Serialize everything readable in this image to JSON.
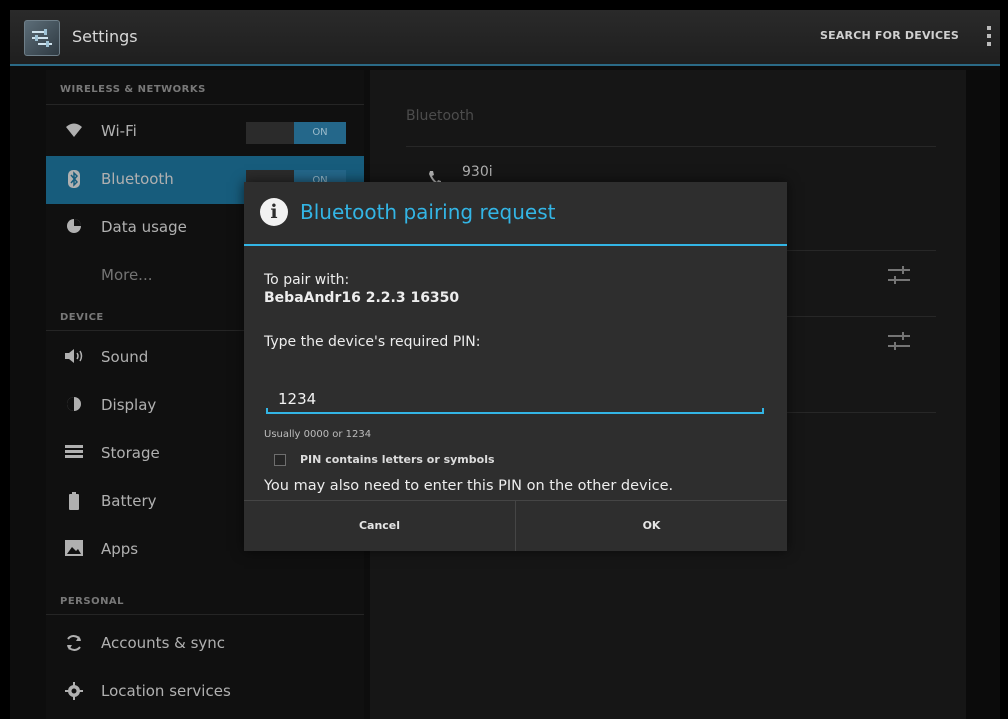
{
  "actionbar": {
    "title": "Settings",
    "search_label": "SEARCH FOR DEVICES"
  },
  "sidebar": {
    "sections": {
      "wireless": "WIRELESS & NETWORKS",
      "device": "DEVICE",
      "personal": "PERSONAL"
    },
    "items": [
      {
        "label": "Wi-Fi",
        "icon": "wifi-icon",
        "toggle": "ON"
      },
      {
        "label": "Bluetooth",
        "icon": "bluetooth-icon",
        "toggle": "ON",
        "active": true
      },
      {
        "label": "Data usage",
        "icon": "data-usage-icon"
      },
      {
        "label": "More..."
      },
      {
        "label": "Sound",
        "icon": "sound-icon"
      },
      {
        "label": "Display",
        "icon": "display-icon"
      },
      {
        "label": "Storage",
        "icon": "storage-icon"
      },
      {
        "label": "Battery",
        "icon": "battery-icon"
      },
      {
        "label": "Apps",
        "icon": "apps-icon"
      },
      {
        "label": "Accounts & sync",
        "icon": "sync-icon"
      },
      {
        "label": "Location services",
        "icon": "location-icon"
      }
    ]
  },
  "detail": {
    "title": "Bluetooth",
    "device_name": "930i"
  },
  "dialog": {
    "title": "Bluetooth pairing request",
    "pair_with_label": "To pair with:",
    "device_id": "BebaAndr16 2.2.3 16350",
    "pin_prompt": "Type the device's required PIN:",
    "pin_value": "1234",
    "pin_hint": "Usually 0000 or 1234",
    "checkbox_label": "PIN contains letters or symbols",
    "checkbox_checked": false,
    "note": "You may also need to enter this PIN on the other device.",
    "cancel_label": "Cancel",
    "ok_label": "OK"
  },
  "colors": {
    "accent": "#33b5e5",
    "selection": "#1c6d92"
  }
}
